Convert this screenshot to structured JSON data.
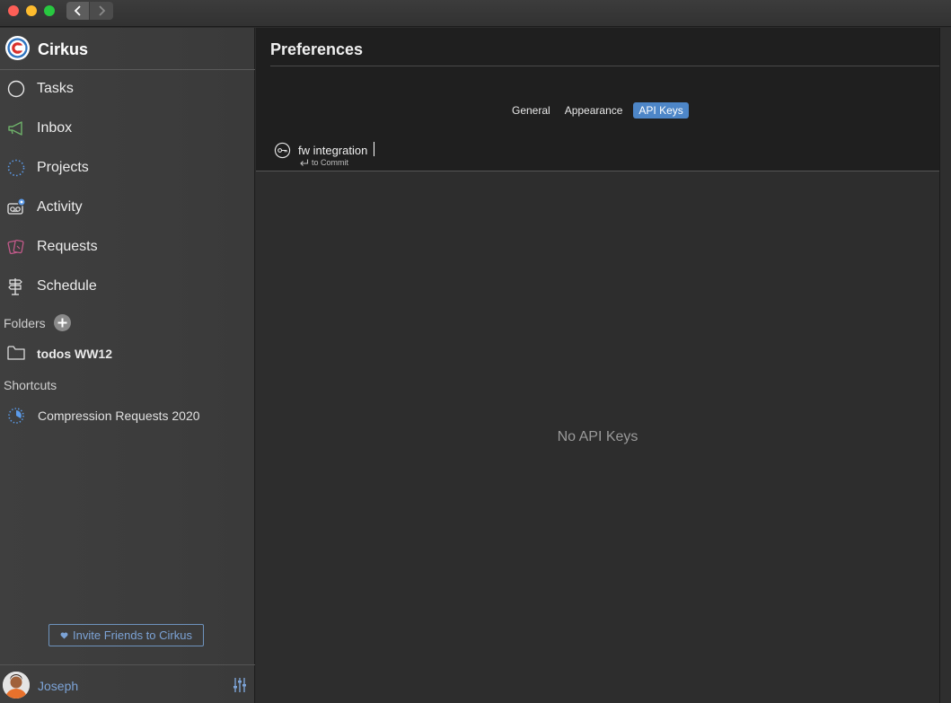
{
  "app": {
    "name": "Cirkus"
  },
  "sidebar": {
    "nav": [
      {
        "label": "Tasks",
        "icon": "circle-icon"
      },
      {
        "label": "Inbox",
        "icon": "megaphone-icon"
      },
      {
        "label": "Projects",
        "icon": "dotted-circle-icon"
      },
      {
        "label": "Activity",
        "icon": "voicemail-icon"
      },
      {
        "label": "Requests",
        "icon": "cards-icon"
      },
      {
        "label": "Schedule",
        "icon": "signpost-icon"
      }
    ],
    "folders_label": "Folders",
    "folders": [
      {
        "label": "todos WW12",
        "icon": "folder-icon"
      }
    ],
    "shortcuts_label": "Shortcuts",
    "shortcuts": [
      {
        "label": "Compression Requests 2020",
        "icon": "project-progress-icon"
      }
    ],
    "invite_label": "Invite Friends to Cirkus",
    "user": {
      "name": "Joseph"
    }
  },
  "preferences": {
    "title": "Preferences",
    "tabs": [
      {
        "label": "General",
        "active": false
      },
      {
        "label": "Appearance",
        "active": false
      },
      {
        "label": "API Keys",
        "active": true
      }
    ],
    "api_key_input": {
      "value": "fw integration"
    },
    "commit_hint": "to Commit",
    "empty_message": "No API Keys"
  },
  "colors": {
    "accent": "#4d86c8",
    "link": "#7ca3d6",
    "activity_badge": "#5b9ae8"
  }
}
